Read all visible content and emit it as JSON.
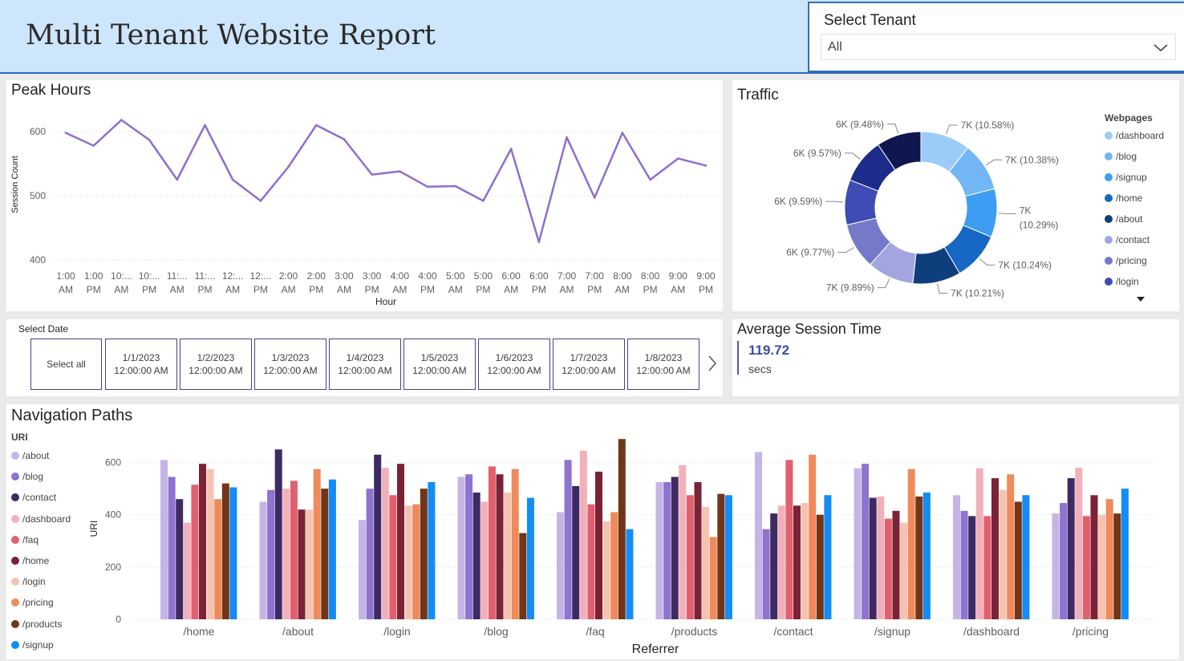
{
  "header": {
    "title": "Multi Tenant Website Report"
  },
  "tenant": {
    "label": "Select Tenant",
    "value": "All"
  },
  "peak_hours": {
    "title": "Peak Hours",
    "chart_data": {
      "type": "line",
      "title": "Peak Hours",
      "xlabel": "Hour",
      "ylabel": "Session Count",
      "x": [
        "1:00 AM",
        "1:00 PM",
        "10:... AM",
        "10:... PM",
        "11:... AM",
        "11:... PM",
        "12:... AM",
        "12:... PM",
        "2:00 AM",
        "2:00 PM",
        "3:00 AM",
        "3:00 PM",
        "4:00 AM",
        "4:00 PM",
        "5:00 AM",
        "5:00 PM",
        "6:00 AM",
        "6:00 PM",
        "7:00 AM",
        "7:00 PM",
        "8:00 AM",
        "8:00 PM",
        "9:00 AM",
        "9:00 PM"
      ],
      "x_tick_lines": [
        [
          "1:00",
          "AM"
        ],
        [
          "1:00",
          "PM"
        ],
        [
          "10:...",
          "AM"
        ],
        [
          "10:...",
          "PM"
        ],
        [
          "11:...",
          "AM"
        ],
        [
          "11:...",
          "PM"
        ],
        [
          "12:...",
          "AM"
        ],
        [
          "12:...",
          "PM"
        ],
        [
          "2:00",
          "AM"
        ],
        [
          "2:00",
          "PM"
        ],
        [
          "3:00",
          "AM"
        ],
        [
          "3:00",
          "PM"
        ],
        [
          "4:00",
          "AM"
        ],
        [
          "4:00",
          "PM"
        ],
        [
          "5:00",
          "AM"
        ],
        [
          "5:00",
          "PM"
        ],
        [
          "6:00",
          "AM"
        ],
        [
          "6:00",
          "PM"
        ],
        [
          "7:00",
          "AM"
        ],
        [
          "7:00",
          "PM"
        ],
        [
          "8:00",
          "AM"
        ],
        [
          "8:00",
          "PM"
        ],
        [
          "9:00",
          "AM"
        ],
        [
          "9:00",
          "PM"
        ]
      ],
      "y": [
        598,
        578,
        618,
        587,
        525,
        610,
        525,
        492,
        545,
        610,
        588,
        533,
        538,
        514,
        515,
        492,
        573,
        428,
        591,
        497,
        598,
        525,
        558,
        547
      ],
      "ylim": [
        380,
        630
      ],
      "yticks": [
        400,
        500,
        600
      ],
      "color": "#8f6fce",
      "grid": true
    }
  },
  "traffic": {
    "title": "Traffic",
    "legend_title": "Webpages",
    "chart_data": {
      "type": "pie",
      "title": "Traffic",
      "legend_title": "Webpages",
      "legend_position": "right",
      "slices": [
        {
          "name": "/dashboard",
          "label": "7K (10.58%)",
          "percent": 10.58,
          "color": "#9ccbf7"
        },
        {
          "name": "/blog",
          "label": "7K (10.38%)",
          "percent": 10.38,
          "color": "#72b6f5"
        },
        {
          "name": "/signup",
          "label": "7K (10.29%)",
          "percent": 10.29,
          "color": "#3d9df1"
        },
        {
          "name": "/home",
          "label": "7K (10.24%)",
          "percent": 10.24,
          "color": "#1768c4"
        },
        {
          "name": "/about",
          "label": "7K (10.21%)",
          "percent": 10.21,
          "color": "#0e3f7c"
        },
        {
          "name": "/contact",
          "label": "7K (9.89%)",
          "percent": 9.89,
          "color": "#a3a6de"
        },
        {
          "name": "/pricing",
          "label": "6K (9.77%)",
          "percent": 9.77,
          "color": "#7579ca"
        },
        {
          "name": "/login",
          "label": "6K (9.59%)",
          "percent": 9.59,
          "color": "#3f4cb5"
        },
        {
          "name": "",
          "label": "6K (9.57%)",
          "percent": 9.57,
          "color": "#1c2b8c"
        },
        {
          "name": "",
          "label": "6K (9.48%)",
          "percent": 9.48,
          "color": "#101750"
        }
      ]
    }
  },
  "date_slicer": {
    "label": "Select Date",
    "select_all": "Select all",
    "tiles": [
      {
        "date": "1/1/2023",
        "time": "12:00:00 AM"
      },
      {
        "date": "1/2/2023",
        "time": "12:00:00 AM"
      },
      {
        "date": "1/3/2023",
        "time": "12:00:00 AM"
      },
      {
        "date": "1/4/2023",
        "time": "12:00:00 AM"
      },
      {
        "date": "1/5/2023",
        "time": "12:00:00 AM"
      },
      {
        "date": "1/6/2023",
        "time": "12:00:00 AM"
      },
      {
        "date": "1/7/2023",
        "time": "12:00:00 AM"
      },
      {
        "date": "1/8/2023",
        "time": "12:00:00 AM"
      }
    ]
  },
  "avg_session": {
    "title": "Average Session Time",
    "value": "119.72",
    "unit": "secs"
  },
  "navigation": {
    "title": "Navigation Paths",
    "chart_data": {
      "type": "bar",
      "title": "Navigation Paths",
      "xlabel": "Referrer",
      "ylabel": "URI",
      "legend_title": "URI",
      "legend_position": "left",
      "ylim": [
        0,
        700
      ],
      "yticks": [
        0,
        200,
        400,
        600
      ],
      "grid": true,
      "categories": [
        "/home",
        "/about",
        "/login",
        "/blog",
        "/faq",
        "/products",
        "/contact",
        "/signup",
        "/dashboard",
        "/pricing"
      ],
      "series": [
        {
          "name": "/about",
          "color": "#c5b5e6",
          "values": [
            610,
            450,
            380,
            545,
            410,
            525,
            640,
            578,
            475,
            405
          ]
        },
        {
          "name": "/blog",
          "color": "#8e73d1",
          "values": [
            545,
            495,
            500,
            555,
            610,
            525,
            345,
            595,
            415,
            445
          ]
        },
        {
          "name": "/contact",
          "color": "#3e2a62",
          "values": [
            460,
            650,
            630,
            485,
            510,
            545,
            405,
            465,
            395,
            540
          ]
        },
        {
          "name": "/dashboard",
          "color": "#f2b1ba",
          "values": [
            370,
            500,
            580,
            450,
            645,
            590,
            435,
            470,
            578,
            580
          ]
        },
        {
          "name": "/faq",
          "color": "#e0606e",
          "values": [
            515,
            530,
            475,
            585,
            440,
            475,
            610,
            385,
            395,
            395
          ]
        },
        {
          "name": "/home",
          "color": "#7a2236",
          "values": [
            595,
            420,
            595,
            555,
            565,
            525,
            435,
            415,
            540,
            475
          ]
        },
        {
          "name": "/login",
          "color": "#f5c3b0",
          "values": [
            575,
            420,
            435,
            485,
            375,
            430,
            445,
            370,
            495,
            400
          ]
        },
        {
          "name": "/pricing",
          "color": "#ee8a5b",
          "values": [
            460,
            575,
            440,
            575,
            410,
            315,
            630,
            575,
            555,
            460
          ]
        },
        {
          "name": "/products",
          "color": "#713518",
          "values": [
            520,
            500,
            500,
            330,
            690,
            480,
            400,
            470,
            450,
            405
          ]
        },
        {
          "name": "/signup",
          "color": "#138cf5",
          "values": [
            505,
            535,
            525,
            465,
            345,
            475,
            475,
            485,
            475,
            500
          ]
        }
      ]
    }
  },
  "icons": {
    "dropdown": "chevron-down-icon",
    "next": "chevron-right-icon",
    "legend_more": "caret-down-icon"
  }
}
